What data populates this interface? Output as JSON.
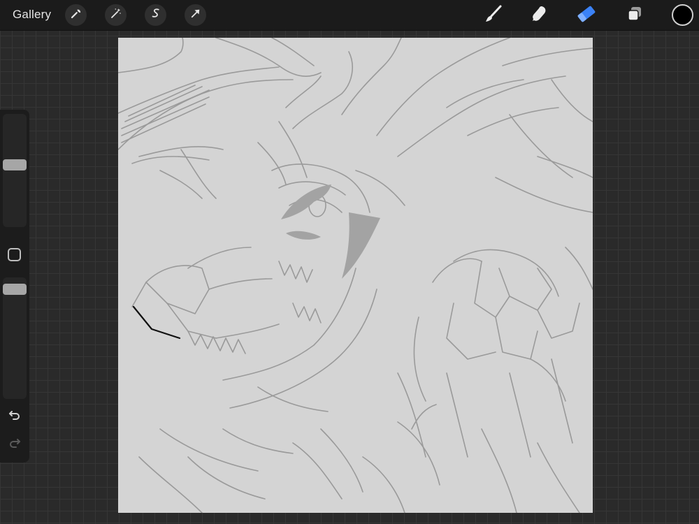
{
  "topbar": {
    "gallery_label": "Gallery",
    "left_tools": [
      "wrench-icon",
      "magic-wand-icon",
      "selection-icon",
      "transform-arrow-icon"
    ],
    "right_tools": [
      "brush-icon",
      "smudge-icon",
      "eraser-icon",
      "layers-icon"
    ],
    "active_tool": "eraser",
    "current_color": "#000000"
  },
  "sidebar": {
    "brush_size_slider": "brush-size",
    "opacity_slider": "opacity",
    "undo_icon": "undo-icon",
    "redo_icon": "redo-icon"
  },
  "colors": {
    "accent": "#3b82f6",
    "canvas": "#d4d4d4",
    "sketch_line": "#9a9a9a"
  }
}
